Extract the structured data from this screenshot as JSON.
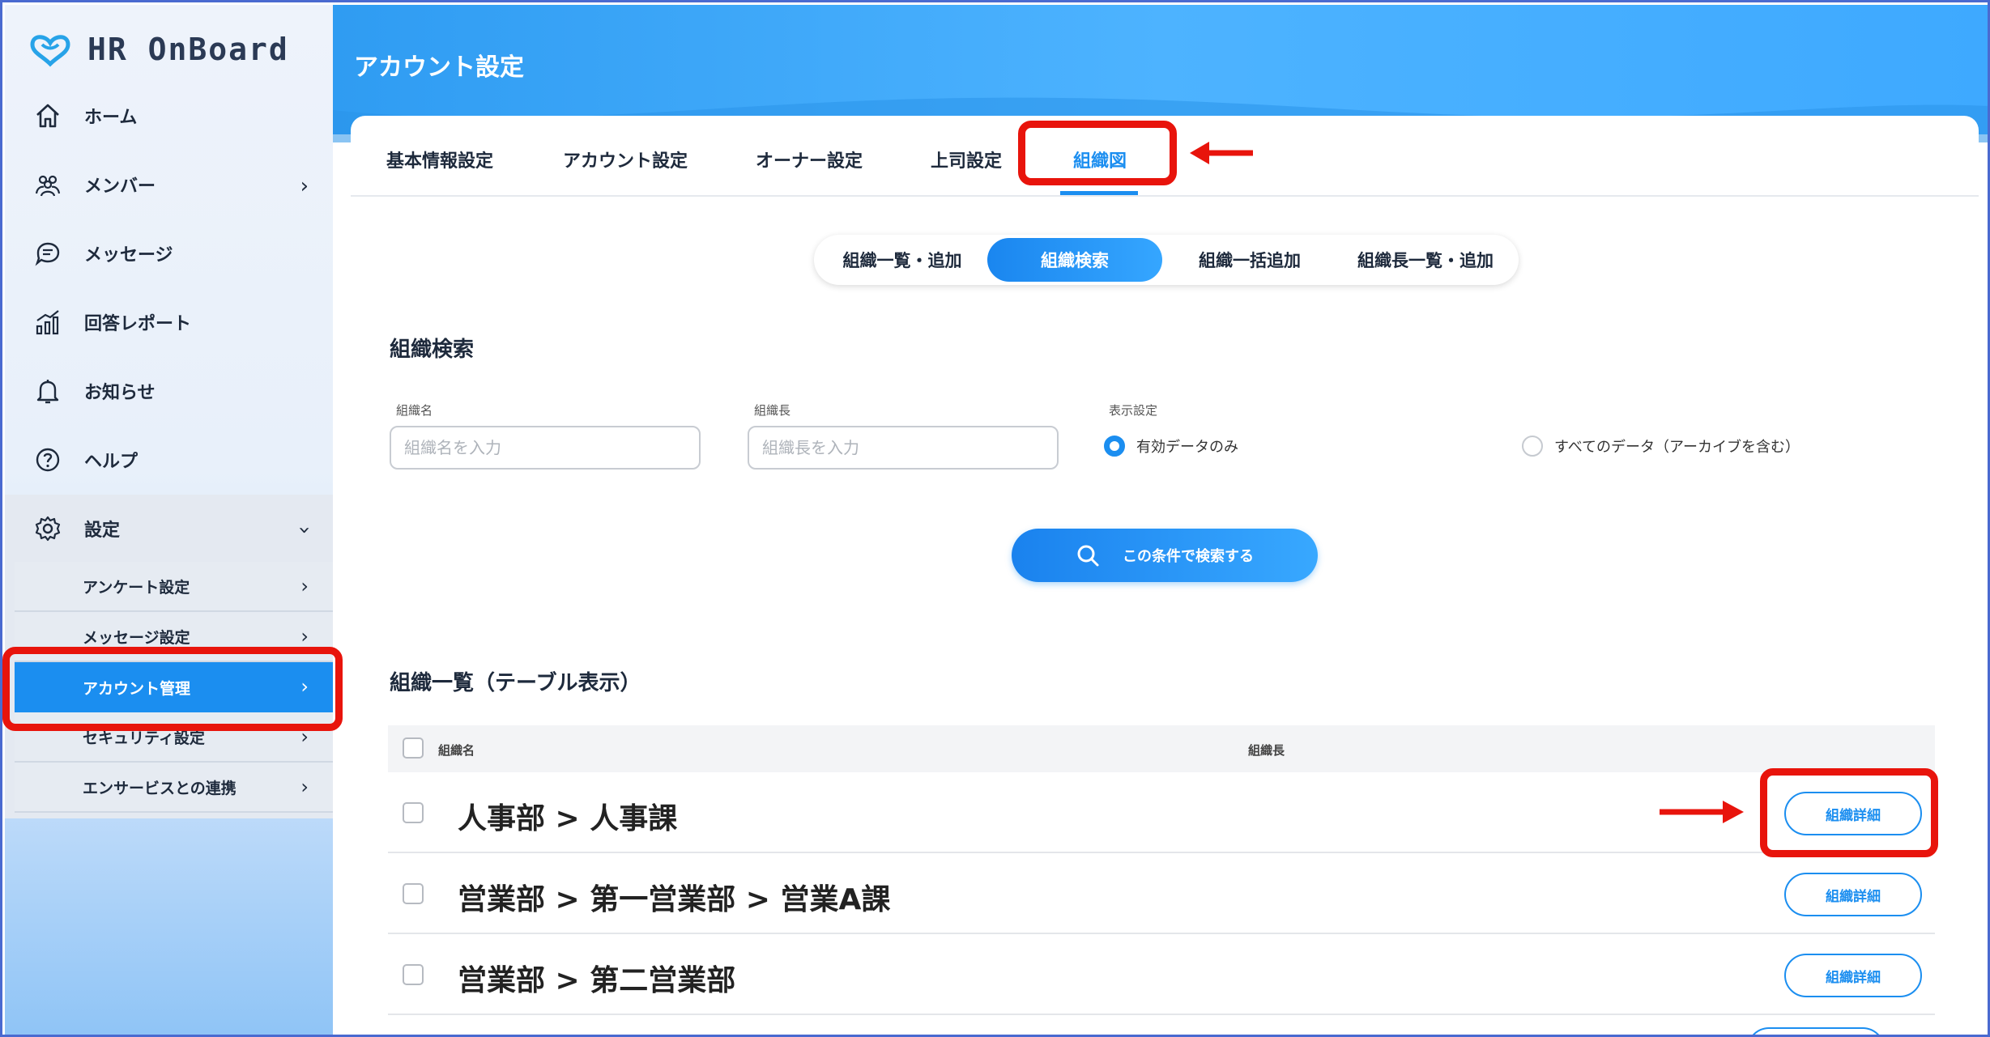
{
  "app": {
    "name": "HR OnBoard"
  },
  "sidebar": {
    "items": [
      {
        "label": "ホーム",
        "icon": "home-icon"
      },
      {
        "label": "メンバー",
        "icon": "members-icon",
        "has_arrow": true
      },
      {
        "label": "メッセージ",
        "icon": "message-icon"
      },
      {
        "label": "回答レポート",
        "icon": "report-icon"
      },
      {
        "label": "お知らせ",
        "icon": "bell-icon"
      },
      {
        "label": "ヘルプ",
        "icon": "help-icon"
      },
      {
        "label": "設定",
        "icon": "gear-icon",
        "expanded": true
      }
    ],
    "sub_items": [
      {
        "label": "アンケート設定"
      },
      {
        "label": "メッセージ設定"
      },
      {
        "label": "アカウント管理",
        "active": true
      },
      {
        "label": "セキュリティ設定"
      },
      {
        "label": "エンサービスとの連携"
      }
    ]
  },
  "page": {
    "title": "アカウント設定"
  },
  "tabs": [
    {
      "label": "基本情報設定"
    },
    {
      "label": "アカウント設定"
    },
    {
      "label": "オーナー設定"
    },
    {
      "label": "上司設定"
    },
    {
      "label": "組織図",
      "active": true
    }
  ],
  "segments": [
    {
      "label": "組織一覧・追加"
    },
    {
      "label": "組織検索",
      "active": true
    },
    {
      "label": "組織一括追加"
    },
    {
      "label": "組織長一覧・追加"
    }
  ],
  "search": {
    "title": "組織検索",
    "org_name_label": "組織名",
    "org_name_placeholder": "組織名を入力",
    "head_label": "組織長",
    "head_placeholder": "組織長を入力",
    "display_label": "表示設定",
    "radio_active": "有効データのみ",
    "radio_all": "すべてのデータ（アーカイブを含む）",
    "button": "この条件で検索する"
  },
  "table": {
    "title": "組織一覧（テーブル表示）",
    "col_name": "組織名",
    "col_head": "組織長",
    "rows": [
      {
        "name": "人事部 > 人事課",
        "button": "組織詳細"
      },
      {
        "name": "営業部 > 第一営業部 > 営業A課",
        "button": "組織詳細"
      },
      {
        "name": "営業部 > 第二営業部",
        "button": "組織詳細"
      }
    ]
  },
  "colors": {
    "accent": "#1b8ef0",
    "highlight": "#e8140c"
  }
}
